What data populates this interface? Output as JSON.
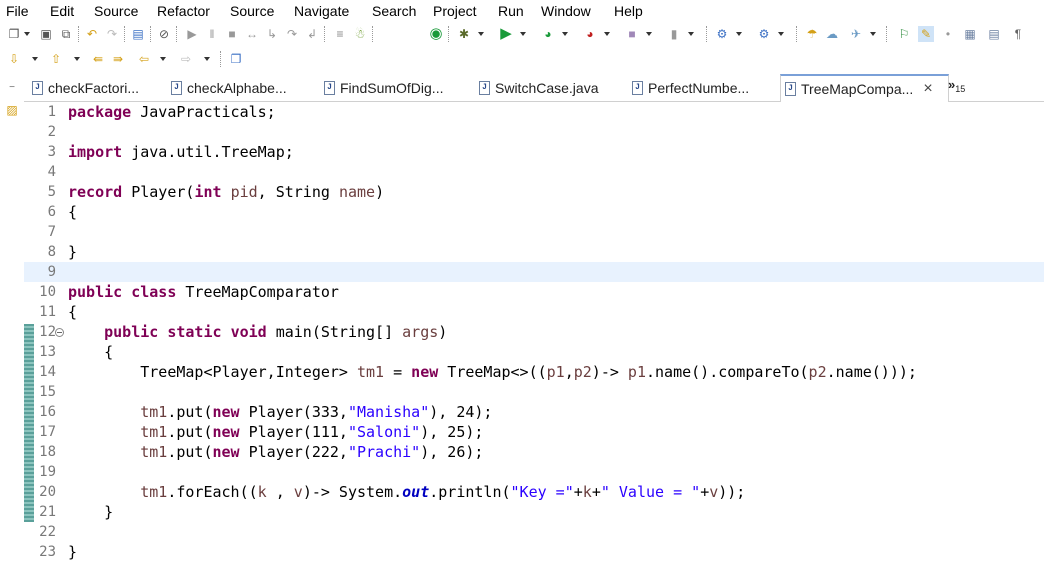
{
  "menu": [
    "File",
    "Edit",
    "Source",
    "Refactor",
    "Source",
    "Navigate",
    "Search",
    "Project",
    "Run",
    "Window",
    "Help"
  ],
  "tabs": [
    {
      "label": "checkFactori...",
      "icon": "J"
    },
    {
      "label": "checkAlphabe...",
      "icon": "J"
    },
    {
      "label": "FindSumOfDig...",
      "icon": "J"
    },
    {
      "label": "SwitchCase.java",
      "icon": "J"
    },
    {
      "label": "PerfectNumbe...",
      "icon": "J"
    },
    {
      "label": "TreeMapCompa...",
      "icon": "J",
      "active": true
    }
  ],
  "overflow_label": "»",
  "overflow_count": "15",
  "close_glyph": "×",
  "colors": {
    "keyword": "#7f0055",
    "string": "#2a00ff",
    "field": "#0000c0",
    "line_highlight": "#e8f2fe",
    "change_bar": "#5aa09a"
  },
  "lines": [
    {
      "n": "1",
      "html": "<span class=\"kw\">package</span> JavaPracticals;"
    },
    {
      "n": "2",
      "html": ""
    },
    {
      "n": "3",
      "html": "<span class=\"kw\">import</span> java.util.TreeMap;"
    },
    {
      "n": "4",
      "html": ""
    },
    {
      "n": "5",
      "html": "<span class=\"kw\">record</span> Player(<span class=\"kw\">int</span> <span class=\"rec\">pid</span>, String <span class=\"rec\">name</span>)"
    },
    {
      "n": "6",
      "html": "{"
    },
    {
      "n": "7",
      "html": ""
    },
    {
      "n": "8",
      "html": "}"
    },
    {
      "n": "9",
      "html": "",
      "highlight": true
    },
    {
      "n": "10",
      "html": "<span class=\"kw\">public</span> <span class=\"kw\">class</span> TreeMapComparator"
    },
    {
      "n": "11",
      "html": "{"
    },
    {
      "n": "12",
      "html": "    <span class=\"kw\">public</span> <span class=\"kw\">static</span> <span class=\"kw\">void</span> main(String[] <span class=\"var\">args</span>)",
      "fold": true
    },
    {
      "n": "13",
      "html": "    {"
    },
    {
      "n": "14",
      "html": "        TreeMap&lt;Player,Integer&gt; <span class=\"var\">tm1</span> = <span class=\"kw\">new</span> TreeMap&lt;&gt;((<span class=\"var\">p1</span>,<span class=\"var\">p2</span>)-&gt; <span class=\"var\">p1</span>.name().compareTo(<span class=\"var\">p2</span>.name()));"
    },
    {
      "n": "15",
      "html": ""
    },
    {
      "n": "16",
      "html": "        <span class=\"var\">tm1</span>.put(<span class=\"kw\">new</span> Player(333,<span class=\"str\">\"Manisha\"</span>), 24);"
    },
    {
      "n": "17",
      "html": "        <span class=\"var\">tm1</span>.put(<span class=\"kw\">new</span> Player(111,<span class=\"str\">\"Saloni\"</span>), 25);"
    },
    {
      "n": "18",
      "html": "        <span class=\"var\">tm1</span>.put(<span class=\"kw\">new</span> Player(222,<span class=\"str\">\"Prachi\"</span>), 26);"
    },
    {
      "n": "19",
      "html": ""
    },
    {
      "n": "20",
      "html": "        <span class=\"var\">tm1</span>.forEach((<span class=\"var\">k</span> , <span class=\"var\">v</span>)-&gt; System.<span class=\"fld\">out</span>.println(<span class=\"str\">\"Key =\"</span>+<span class=\"var\">k</span>+<span class=\"str\">\" Value = \"</span>+<span class=\"var\">v</span>));"
    },
    {
      "n": "21",
      "html": "    }"
    },
    {
      "n": "22",
      "html": ""
    },
    {
      "n": "23",
      "html": "}"
    }
  ]
}
